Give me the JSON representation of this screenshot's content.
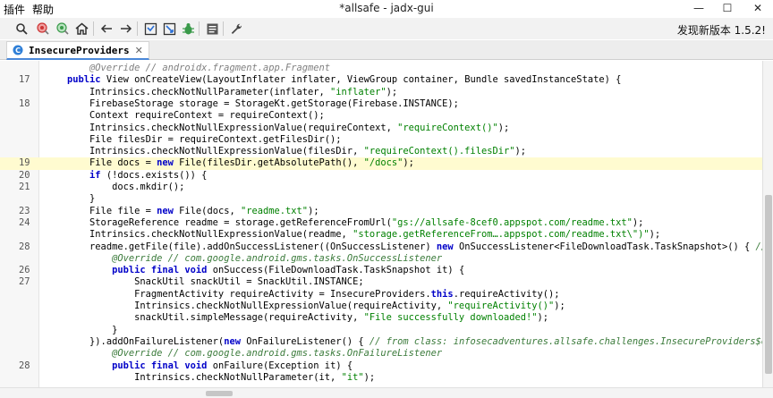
{
  "menu": {
    "plugins": "插件",
    "help": "帮助"
  },
  "window": {
    "title": "*allsafe - jadx-gui",
    "minimize": "—",
    "maximize": "☐",
    "close": "✕"
  },
  "toolbar": {
    "update_notice": "发现新版本 1.5.2!"
  },
  "tab": {
    "label": "InsecureProviders",
    "close": "✕"
  },
  "code_lines": [
    {
      "ln": "",
      "parts": [
        {
          "t": "        ",
          "c": ""
        },
        {
          "t": "@Override // androidx.fragment.app.Fragment",
          "c": "cm"
        }
      ]
    },
    {
      "ln": "17",
      "parts": [
        {
          "t": "    ",
          "c": ""
        },
        {
          "t": "public",
          "c": "kw"
        },
        {
          "t": " View onCreateView(LayoutInflater inflater, ViewGroup container, Bundle savedInstanceState) {",
          "c": ""
        }
      ]
    },
    {
      "ln": "",
      "parts": [
        {
          "t": "        Intrinsics.checkNotNullParameter(inflater, ",
          "c": ""
        },
        {
          "t": "\"inflater\"",
          "c": "st"
        },
        {
          "t": ");",
          "c": ""
        }
      ]
    },
    {
      "ln": "18",
      "parts": [
        {
          "t": "        FirebaseStorage storage = StorageKt.getStorage(Firebase.INSTANCE);",
          "c": ""
        }
      ]
    },
    {
      "ln": "",
      "parts": [
        {
          "t": "        Context requireContext = requireContext();",
          "c": ""
        }
      ]
    },
    {
      "ln": "",
      "parts": [
        {
          "t": "        Intrinsics.checkNotNullExpressionValue(requireContext, ",
          "c": ""
        },
        {
          "t": "\"requireContext()\"",
          "c": "st"
        },
        {
          "t": ");",
          "c": ""
        }
      ]
    },
    {
      "ln": "",
      "parts": [
        {
          "t": "        File filesDir = requireContext.getFilesDir();",
          "c": ""
        }
      ]
    },
    {
      "ln": "",
      "parts": [
        {
          "t": "        Intrinsics.checkNotNullExpressionValue(filesDir, ",
          "c": ""
        },
        {
          "t": "\"requireContext().filesDir\"",
          "c": "st"
        },
        {
          "t": ");",
          "c": ""
        }
      ]
    },
    {
      "ln": "19",
      "hl": true,
      "parts": [
        {
          "t": "        File docs = ",
          "c": ""
        },
        {
          "t": "new",
          "c": "kw"
        },
        {
          "t": " File(filesDir.getAbsolutePath(), ",
          "c": ""
        },
        {
          "t": "\"/docs\"",
          "c": "st"
        },
        {
          "t": ");",
          "c": ""
        }
      ]
    },
    {
      "ln": "20",
      "parts": [
        {
          "t": "        ",
          "c": ""
        },
        {
          "t": "if",
          "c": "kw"
        },
        {
          "t": " (!docs.exists()) {",
          "c": ""
        }
      ]
    },
    {
      "ln": "21",
      "parts": [
        {
          "t": "            docs.mkdir();",
          "c": ""
        }
      ]
    },
    {
      "ln": "",
      "parts": [
        {
          "t": "        }",
          "c": ""
        }
      ]
    },
    {
      "ln": "23",
      "parts": [
        {
          "t": "        File file = ",
          "c": ""
        },
        {
          "t": "new",
          "c": "kw"
        },
        {
          "t": " File(docs, ",
          "c": ""
        },
        {
          "t": "\"readme.txt\"",
          "c": "st"
        },
        {
          "t": ");",
          "c": ""
        }
      ]
    },
    {
      "ln": "24",
      "parts": [
        {
          "t": "        StorageReference readme = storage.getReferenceFromUrl(",
          "c": ""
        },
        {
          "t": "\"gs://allsafe-8cef0.appspot.com/readme.txt\"",
          "c": "st"
        },
        {
          "t": ");",
          "c": ""
        }
      ]
    },
    {
      "ln": "",
      "parts": [
        {
          "t": "        Intrinsics.checkNotNullExpressionValue(readme, ",
          "c": ""
        },
        {
          "t": "\"storage.getReferenceFrom….appspot.com/readme.txt\\\")\"",
          "c": "st"
        },
        {
          "t": ");",
          "c": ""
        }
      ]
    },
    {
      "ln": "28",
      "parts": [
        {
          "t": "        readme.getFile(file).addOnSuccessListener((OnSuccessListener) ",
          "c": ""
        },
        {
          "t": "new",
          "c": "kw"
        },
        {
          "t": " OnSuccessListener<FileDownloadTask.TaskSnapshot>() { ",
          "c": ""
        },
        {
          "t": "// from",
          "c": "gr"
        }
      ]
    },
    {
      "ln": "",
      "parts": [
        {
          "t": "            ",
          "c": ""
        },
        {
          "t": "@Override // com.google.android.gms.tasks.OnSuccessListener",
          "c": "gr"
        }
      ]
    },
    {
      "ln": "26",
      "parts": [
        {
          "t": "            ",
          "c": ""
        },
        {
          "t": "public final void",
          "c": "kw"
        },
        {
          "t": " onSuccess(FileDownloadTask.TaskSnapshot it) {",
          "c": ""
        }
      ]
    },
    {
      "ln": "27",
      "parts": [
        {
          "t": "                SnackUtil snackUtil = SnackUtil.INSTANCE;",
          "c": ""
        }
      ]
    },
    {
      "ln": "",
      "parts": [
        {
          "t": "                FragmentActivity requireActivity = InsecureProviders.",
          "c": ""
        },
        {
          "t": "this",
          "c": "kw"
        },
        {
          "t": ".requireActivity();",
          "c": ""
        }
      ]
    },
    {
      "ln": "",
      "parts": [
        {
          "t": "                Intrinsics.checkNotNullExpressionValue(requireActivity, ",
          "c": ""
        },
        {
          "t": "\"requireActivity()\"",
          "c": "st"
        },
        {
          "t": ");",
          "c": ""
        }
      ]
    },
    {
      "ln": "",
      "parts": [
        {
          "t": "                snackUtil.simpleMessage(requireActivity, ",
          "c": ""
        },
        {
          "t": "\"File successfully downloaded!\"",
          "c": "st"
        },
        {
          "t": ");",
          "c": ""
        }
      ]
    },
    {
      "ln": "",
      "parts": [
        {
          "t": "            }",
          "c": ""
        }
      ]
    },
    {
      "ln": "",
      "parts": [
        {
          "t": "        }).addOnFailureListener(",
          "c": ""
        },
        {
          "t": "new",
          "c": "kw"
        },
        {
          "t": " OnFailureListener() { ",
          "c": ""
        },
        {
          "t": "// from class: infosecadventures.allsafe.challenges.InsecureProviders$onCreat",
          "c": "gr"
        }
      ]
    },
    {
      "ln": "",
      "parts": [
        {
          "t": "            ",
          "c": ""
        },
        {
          "t": "@Override // com.google.android.gms.tasks.OnFailureListener",
          "c": "gr"
        }
      ]
    },
    {
      "ln": "28",
      "parts": [
        {
          "t": "            ",
          "c": ""
        },
        {
          "t": "public final void",
          "c": "kw"
        },
        {
          "t": " onFailure(Exception it) {",
          "c": ""
        }
      ]
    },
    {
      "ln": "",
      "parts": [
        {
          "t": "                Intrinsics.checkNotNullParameter(it, ",
          "c": ""
        },
        {
          "t": "\"it\"",
          "c": "st"
        },
        {
          "t": ");",
          "c": ""
        }
      ]
    }
  ]
}
